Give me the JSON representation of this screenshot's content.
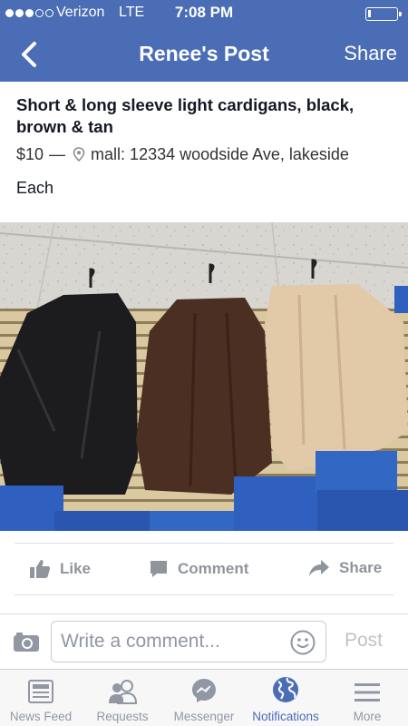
{
  "status_bar": {
    "carrier": "Verizon",
    "network": "LTE",
    "time": "7:08 PM"
  },
  "nav": {
    "title": "Renee's Post",
    "share_label": "Share"
  },
  "post": {
    "title": "Short & long sleeve light cardigans, black, brown & tan",
    "price": "$10",
    "separator": "—",
    "location": "mall: 12334 woodside Ave, lakeside",
    "body": "Each"
  },
  "actions": {
    "like": "Like",
    "comment": "Comment",
    "share": "Share"
  },
  "comment_bar": {
    "placeholder": "Write a comment...",
    "post_label": "Post"
  },
  "tabs": [
    {
      "label": "News Feed",
      "icon": "news-feed-icon"
    },
    {
      "label": "Requests",
      "icon": "friend-requests-icon"
    },
    {
      "label": "Messenger",
      "icon": "messenger-icon"
    },
    {
      "label": "Notifications",
      "icon": "globe-icon",
      "active": true
    },
    {
      "label": "More",
      "icon": "menu-icon"
    }
  ],
  "colors": {
    "brand": "#4a6db5",
    "inactive": "#9197a3"
  }
}
